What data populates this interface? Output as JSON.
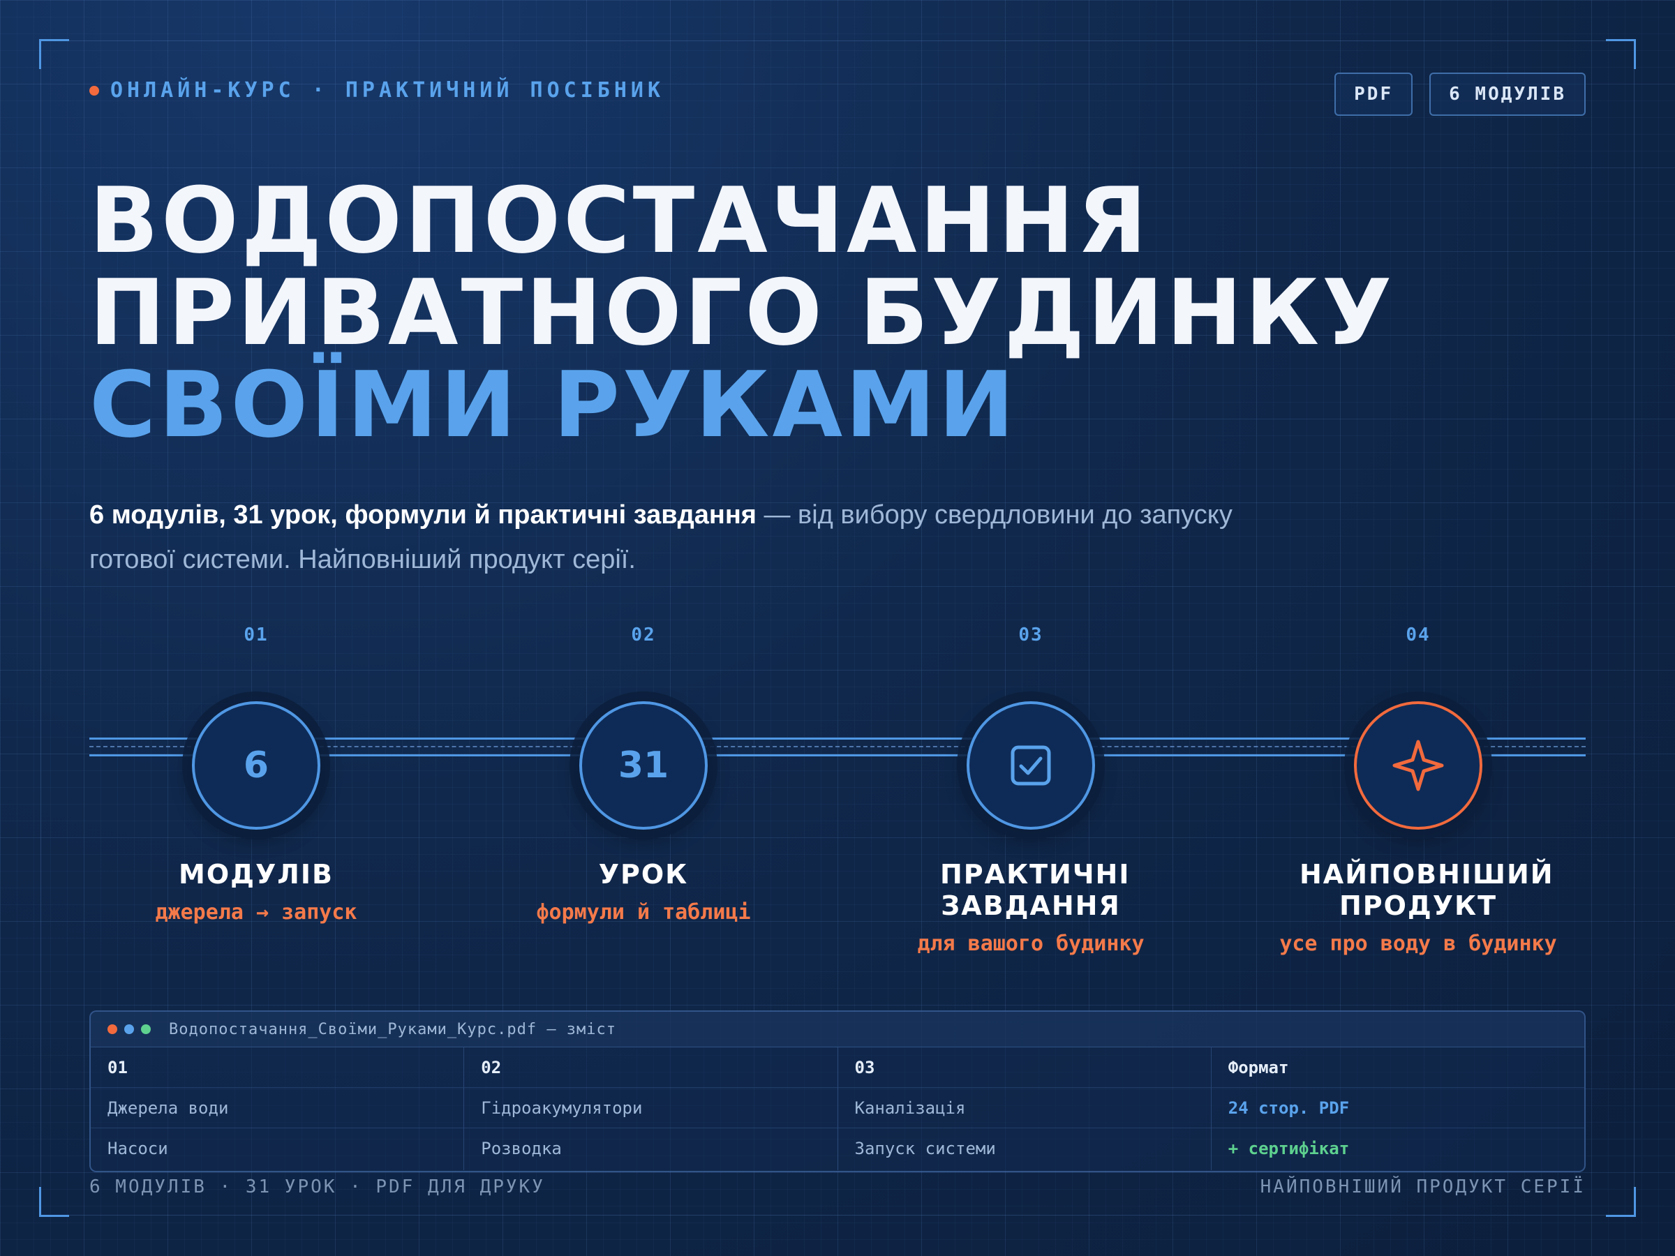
{
  "header": {
    "eyebrow": "ОНЛАЙН-КУРС · ПРАКТИЧНИЙ ПОСІБНИК",
    "badges": [
      "PDF",
      "6 МОДУЛІВ"
    ]
  },
  "title": {
    "line1": "ВОДОПОСТАЧАННЯ",
    "line2": "ПРИВАТНОГО БУДИНКУ",
    "line3": "СВОЇМИ РУКАМИ"
  },
  "lead": {
    "bold": "6 модулів, 31 урок, формули й практичні завдання",
    "rest": " — від вибору свердловини до запуску готової системи. Найповніший продукт серії."
  },
  "steps": [
    {
      "num": "01",
      "value": "6",
      "label": "МОДУЛІВ",
      "sub": "джерела → запуск"
    },
    {
      "num": "02",
      "value": "31",
      "label": "УРОК",
      "sub": "формули й таблиці"
    },
    {
      "num": "03",
      "icon": "checkbox-icon",
      "label": "ПРАКТИЧНІ ЗАВДАННЯ",
      "sub": "для вашого будинку"
    },
    {
      "num": "04",
      "icon": "sparkle-icon",
      "label": "НАЙПОВНІШИЙ ПРОДУКТ",
      "sub": "усе про воду в будинку"
    }
  ],
  "doc": {
    "title": "Водопостачання_Своїми_Руками_Курс.pdf — зміст",
    "columns": [
      {
        "header": "01",
        "items": [
          "Джерела води",
          "Насоси"
        ]
      },
      {
        "header": "02",
        "items": [
          "Гідроакумулятори",
          "Розводка"
        ]
      },
      {
        "header": "03",
        "items": [
          "Каналізація",
          "Запуск системи"
        ]
      },
      {
        "header": "Формат",
        "items": [
          "24 стор. PDF",
          "+ сертифікат"
        ]
      }
    ]
  },
  "footer": {
    "left": "6 МОДУЛІВ · 31 УРОК · PDF ДЛЯ ДРУКУ",
    "right": "НАЙПОВНІШИЙ ПРОДУКТ СЕРІЇ"
  },
  "colors": {
    "accent_blue": "#5aa3ec",
    "accent_orange": "#f26a3d",
    "accent_green": "#5ed18f",
    "background": "#10284c"
  }
}
